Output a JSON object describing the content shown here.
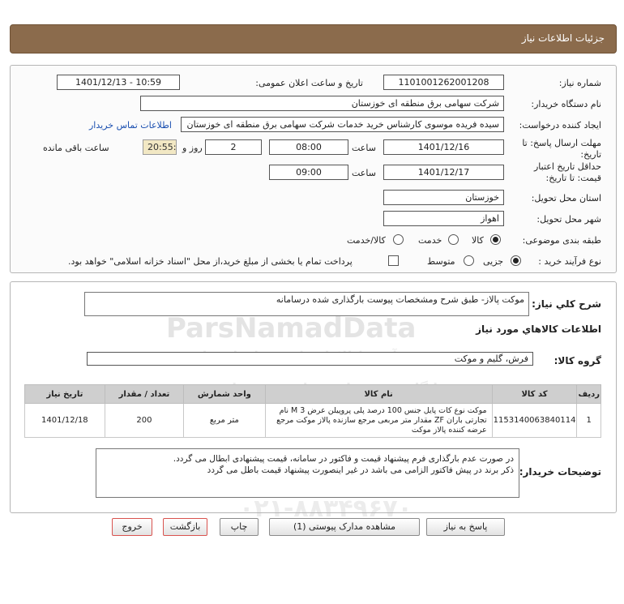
{
  "page_title": "جزئیات اطلاعات نیاز",
  "form": {
    "need_number_label": "شماره نیاز:",
    "need_number": "1101001262001208",
    "announce_label": "تاریخ و ساعت اعلان عمومی:",
    "announce_value": "1401/12/13 - 10:59",
    "buyer_org_label": "نام دستگاه خریدار:",
    "buyer_org": "شرکت سهامی برق منطقه ای خوزستان",
    "creator_label": "ایجاد کننده درخواست:",
    "creator": "سیده فریده موسوی کارشناس خرید خدمات شرکت سهامی برق منطقه ای خوزستان",
    "contact_link": "اطلاعات تماس خریدار",
    "deadline_label": "مهلت ارسال پاسخ: تا تاریخ:",
    "deadline_date": "1401/12/16",
    "time_label": "ساعت",
    "deadline_time": "08:00",
    "days_value": "2",
    "days_label": "روز و",
    "remaining_time": "20:55:53",
    "remaining_label": "ساعت باقی مانده",
    "validity_label": "حداقل تاریخ اعتبار قیمت: تا تاریخ:",
    "validity_date": "1401/12/17",
    "validity_time": "09:00",
    "province_label": "استان محل تحویل:",
    "province": "خوزستان",
    "city_label": "شهر محل تحویل:",
    "city": "اهواز",
    "category_label": "طبقه بندی موضوعی:",
    "category_options": [
      "کالا",
      "خدمت",
      "کالا/خدمت"
    ],
    "process_label": "نوع فرآیند خرید :",
    "process_options": [
      "جزیی",
      "متوسط"
    ],
    "payment_note": "پرداخت تمام یا بخشی از مبلغ خرید،از محل \"اسناد خزانه اسلامی\" خواهد بود."
  },
  "summary": {
    "label": "شرح کلي نياز:",
    "value": "موکت پالاز- طبق شرح ومشخصات پیوست بارگذاری شده درسامانه"
  },
  "goods_section_title": "اطلاعات کالاهاي مورد نياز",
  "goods_group": {
    "label": "گروه کالا:",
    "value": "فرش، گلیم و موکت"
  },
  "table": {
    "headers": [
      "ردیف",
      "کد کالا",
      "نام کالا",
      "واحد شمارش",
      "تعداد / مقدار",
      "تاریخ نیاز"
    ],
    "rows": [
      {
        "row": "1",
        "code": "1153140063840114",
        "name": "موکت نوع کات پایل جنس 100 درصد پلی پروپیلن عرض 3 M نام تجارتی باران ZF مقدار متر مربعی مرجع سازنده پالاز موکت مرجع عرضه کننده پالاز موکت",
        "unit": "متر مربع",
        "qty": "200",
        "date": "1401/12/18"
      }
    ]
  },
  "buyer_notes": {
    "label": "توضیحات خریدار:",
    "line1": "در صورت عدم بارگذاری فرم پیشنهاد قیمت و فاکتور در سامانه، قیمت پیشنهادی ابطال می گردد.",
    "line2": "ذکر برند در پیش فاکتور الزامی می باشد در غیر اینصورت پیشنهاد قیمت باطل می گردد"
  },
  "buttons": {
    "reply": "پاسخ به نیاز",
    "attachments": "مشاهده مدارک پیوستی (1)",
    "print": "چاپ",
    "back": "بازگشت",
    "exit": "خروج"
  },
  "watermark": {
    "brand": "ParsNamadData",
    "line1": "پایگاه خبر رسانی مناقصه و مزایده",
    "line2": "فرآوری اطلاعات پارس نماد داده ها",
    "phone": "۰۲۱-۸۸۳۴۹۶۷۰"
  },
  "colors": {
    "header_bg": "#8b6b4c",
    "highlight_field": "#f2e8c4",
    "link": "#1a4fb0",
    "exit_border": "#d9534f"
  }
}
